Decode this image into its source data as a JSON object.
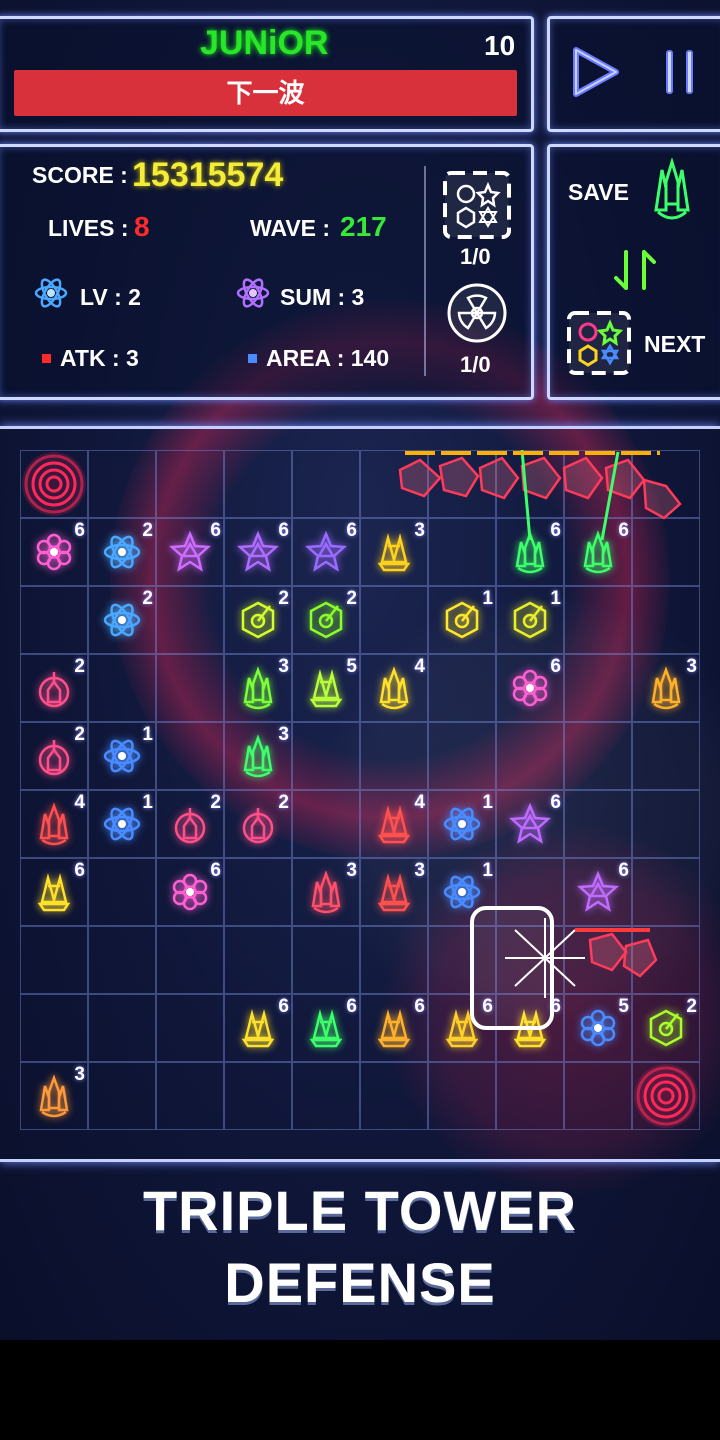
{
  "header": {
    "rank": "JUNiOR",
    "wave_countdown": "10",
    "next_wave_button": "下一波"
  },
  "controls": {
    "play_icon": "play-icon",
    "pause_icon": "pause-icon"
  },
  "stats": {
    "score_label": "SCORE :",
    "score_value": "15315574",
    "lives_label": "LIVES :",
    "lives_value": "8",
    "wave_label": "WAVE :",
    "wave_value": "217",
    "lv_label": "LV : 2",
    "sum_label": "SUM : 3",
    "atk_label": "ATK : 3",
    "area_label": "AREA : 140",
    "powerup1_count": "1/0",
    "powerup2_count": "1/0"
  },
  "side": {
    "save_label": "SAVE",
    "next_label": "NEXT"
  },
  "colors": {
    "accent_yellow": "#f4ec3a",
    "lives_red": "#ff2a2a",
    "wave_green": "#38e838",
    "bar_red": "#d9313b",
    "rank_green": "#29e629"
  },
  "board": {
    "rows": 10,
    "cols": 10,
    "towers": [
      {
        "r": 1,
        "c": 0,
        "lv": "6",
        "color": "#ff5fd2",
        "shape": "flower"
      },
      {
        "r": 1,
        "c": 1,
        "lv": "2",
        "color": "#4aa8ff",
        "shape": "atom"
      },
      {
        "r": 1,
        "c": 2,
        "lv": "6",
        "color": "#d06bff",
        "shape": "star"
      },
      {
        "r": 1,
        "c": 3,
        "lv": "6",
        "color": "#b06bff",
        "shape": "star"
      },
      {
        "r": 1,
        "c": 4,
        "lv": "6",
        "color": "#9a6bff",
        "shape": "star"
      },
      {
        "r": 1,
        "c": 5,
        "lv": "3",
        "color": "#ffd21f",
        "shape": "claw"
      },
      {
        "r": 1,
        "c": 7,
        "lv": "6",
        "color": "#3dff6a",
        "shape": "ship"
      },
      {
        "r": 1,
        "c": 8,
        "lv": "6",
        "color": "#3dff6a",
        "shape": "ship"
      },
      {
        "r": 2,
        "c": 1,
        "lv": "2",
        "color": "#4aa8ff",
        "shape": "atom"
      },
      {
        "r": 2,
        "c": 3,
        "lv": "2",
        "color": "#d4ff2a",
        "shape": "hex"
      },
      {
        "r": 2,
        "c": 4,
        "lv": "2",
        "color": "#8cff2a",
        "shape": "hex"
      },
      {
        "r": 2,
        "c": 6,
        "lv": "1",
        "color": "#ffe82a",
        "shape": "hex"
      },
      {
        "r": 2,
        "c": 7,
        "lv": "1",
        "color": "#e8f02a",
        "shape": "hex"
      },
      {
        "r": 3,
        "c": 0,
        "lv": "2",
        "color": "#ff4f8a",
        "shape": "pod"
      },
      {
        "r": 3,
        "c": 3,
        "lv": "3",
        "color": "#7aff3a",
        "shape": "ship"
      },
      {
        "r": 3,
        "c": 4,
        "lv": "5",
        "color": "#b8ff3a",
        "shape": "claw"
      },
      {
        "r": 3,
        "c": 5,
        "lv": "4",
        "color": "#ffe02a",
        "shape": "ship"
      },
      {
        "r": 3,
        "c": 7,
        "lv": "6",
        "color": "#ff5fd2",
        "shape": "flower"
      },
      {
        "r": 3,
        "c": 9,
        "lv": "3",
        "color": "#ffb02a",
        "shape": "ship"
      },
      {
        "r": 4,
        "c": 0,
        "lv": "2",
        "color": "#ff4f8a",
        "shape": "pod"
      },
      {
        "r": 4,
        "c": 1,
        "lv": "1",
        "color": "#4a8cff",
        "shape": "atom"
      },
      {
        "r": 4,
        "c": 3,
        "lv": "3",
        "color": "#3dff6a",
        "shape": "ship"
      },
      {
        "r": 5,
        "c": 0,
        "lv": "4",
        "color": "#ff5050",
        "shape": "ship"
      },
      {
        "r": 5,
        "c": 1,
        "lv": "1",
        "color": "#4a8cff",
        "shape": "atom"
      },
      {
        "r": 5,
        "c": 2,
        "lv": "2",
        "color": "#ff4f8a",
        "shape": "pod"
      },
      {
        "r": 5,
        "c": 3,
        "lv": "2",
        "color": "#ff4f8a",
        "shape": "pod"
      },
      {
        "r": 5,
        "c": 5,
        "lv": "4",
        "color": "#ff5050",
        "shape": "claw"
      },
      {
        "r": 5,
        "c": 6,
        "lv": "1",
        "color": "#4a8cff",
        "shape": "atom"
      },
      {
        "r": 5,
        "c": 7,
        "lv": "6",
        "color": "#c06bff",
        "shape": "star"
      },
      {
        "r": 6,
        "c": 0,
        "lv": "6",
        "color": "#ffe02a",
        "shape": "claw"
      },
      {
        "r": 6,
        "c": 2,
        "lv": "6",
        "color": "#ff5fd2",
        "shape": "flower"
      },
      {
        "r": 6,
        "c": 4,
        "lv": "3",
        "color": "#ff4f6a",
        "shape": "ship"
      },
      {
        "r": 6,
        "c": 5,
        "lv": "3",
        "color": "#ff5050",
        "shape": "claw"
      },
      {
        "r": 6,
        "c": 6,
        "lv": "1",
        "color": "#4a8cff",
        "shape": "atom"
      },
      {
        "r": 6,
        "c": 8,
        "lv": "6",
        "color": "#c06bff",
        "shape": "star"
      },
      {
        "r": 8,
        "c": 3,
        "lv": "6",
        "color": "#ffe02a",
        "shape": "claw"
      },
      {
        "r": 8,
        "c": 4,
        "lv": "6",
        "color": "#3dff6a",
        "shape": "claw"
      },
      {
        "r": 8,
        "c": 5,
        "lv": "6",
        "color": "#ffb02a",
        "shape": "claw"
      },
      {
        "r": 8,
        "c": 6,
        "lv": "6",
        "color": "#ffd02a",
        "shape": "claw"
      },
      {
        "r": 8,
        "c": 7,
        "lv": "6",
        "color": "#ffe02a",
        "shape": "claw"
      },
      {
        "r": 8,
        "c": 8,
        "lv": "5",
        "color": "#4a8cff",
        "shape": "flower"
      },
      {
        "r": 8,
        "c": 9,
        "lv": "2",
        "color": "#a8ff2a",
        "shape": "hex"
      },
      {
        "r": 9,
        "c": 0,
        "lv": "3",
        "color": "#ff9a3a",
        "shape": "ship"
      }
    ],
    "portals": [
      {
        "r": 0,
        "c": 0
      },
      {
        "r": 9,
        "c": 9
      }
    ]
  },
  "footer": {
    "title_line1": "TRIPLE TOWER",
    "title_line2": "DEFENSE"
  }
}
